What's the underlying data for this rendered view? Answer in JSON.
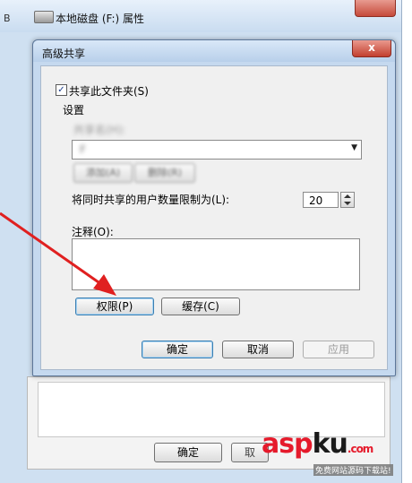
{
  "back_window": {
    "title": "本地磁盘 (F:) 属性",
    "left_letter": "B",
    "ok_label": "确定",
    "cancel_label": "取"
  },
  "dialog": {
    "title": "高级共享",
    "close_glyph": "x",
    "share_checkbox": {
      "label": "共享此文件夹(S)",
      "checked": true
    },
    "settings_label": "设置",
    "share_name_label": "共享名(H):",
    "share_name_value": "F",
    "add_label": "添加(A)",
    "remove_label": "删除(R)",
    "limit_label": "将同时共享的用户数量限制为(L):",
    "limit_value": "20",
    "comment_label": "注释(O):",
    "comment_value": "",
    "permissions_label": "权限(P)",
    "cache_label": "缓存(C)",
    "ok_label": "确定",
    "cancel_label": "取消",
    "apply_label": "应用"
  },
  "icons": {
    "checkbox": "check-icon",
    "dropdown": "chevron-down-icon",
    "spinner": "spinner-icon",
    "drive": "drive-icon",
    "annotation": "red-arrow-icon"
  },
  "colors": {
    "arrow": "#e02020",
    "window_frame": "#c5d9ef",
    "dialog_body": "#f0f0f0"
  },
  "watermark": {
    "part1": "asp",
    "part2": "ku",
    "tld": ".com",
    "subtitle": "免费网站源码下载站!"
  }
}
